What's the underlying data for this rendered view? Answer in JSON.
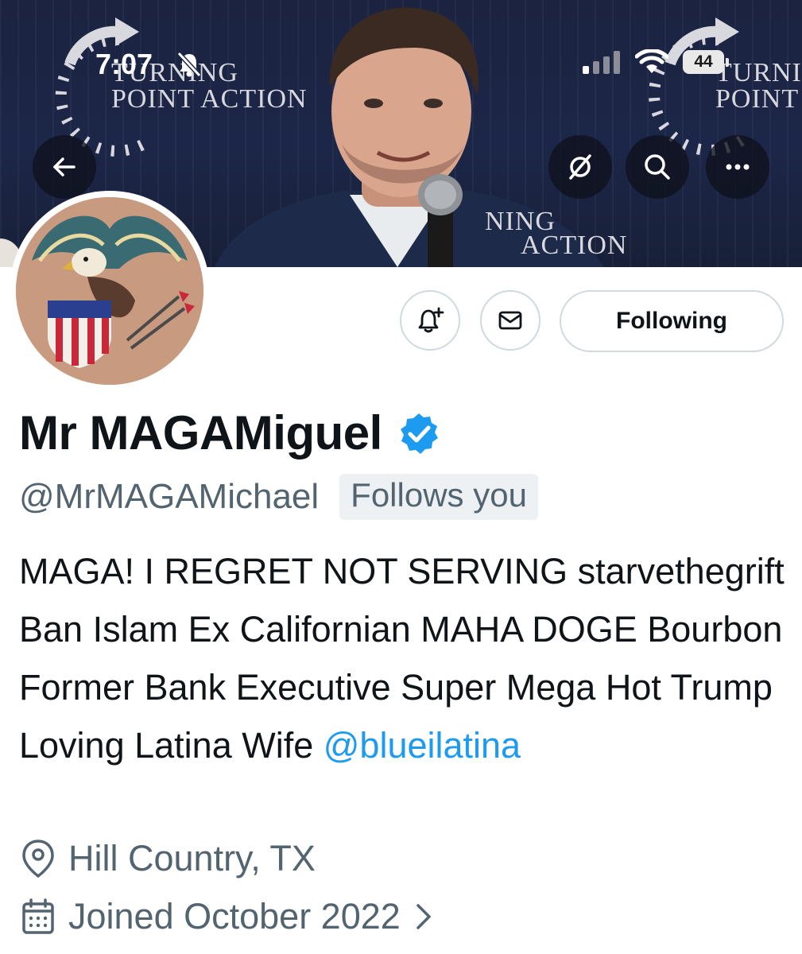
{
  "status_bar": {
    "time": "7:07",
    "battery": "44",
    "icons": [
      "bell-slash-icon",
      "cellular-signal-icon",
      "wifi-icon",
      "battery-icon"
    ]
  },
  "banner": {
    "logo_left": [
      "TURNING",
      "POINT ACTION"
    ],
    "logo_right": [
      "TURNI",
      "POINT"
    ],
    "logo_center": [
      "NING",
      "ACTION"
    ],
    "colors": {
      "background": "#1c2648",
      "logo_text": "#d8d9de"
    }
  },
  "header_buttons": {
    "back": "back-arrow-icon",
    "grok": "slash-circle-icon",
    "search": "search-icon",
    "more": "more-icon"
  },
  "profile": {
    "display_name": "Mr MAGAMiguel",
    "handle": "@MrMAGAMichael",
    "follows_you": "Follows you",
    "bio_text": "MAGA! I REGRET NOT SERVING starvethegrift Ban Islam Ex Californian MAHA DOGE Bourbon Former Bank Executive Super Mega Hot Trump Loving Latina Wife",
    "bio_mention": "@blueilatina",
    "location": "Hill Country, TX",
    "joined": "Joined October 2022",
    "verified": true
  },
  "actions": {
    "following_label": "Following",
    "notify_icon": "bell-plus-icon",
    "message_icon": "envelope-icon"
  },
  "colors": {
    "accent": "#1d9bf0",
    "text": "#0f1419",
    "secondary": "#536471",
    "border": "#cfd9de"
  }
}
